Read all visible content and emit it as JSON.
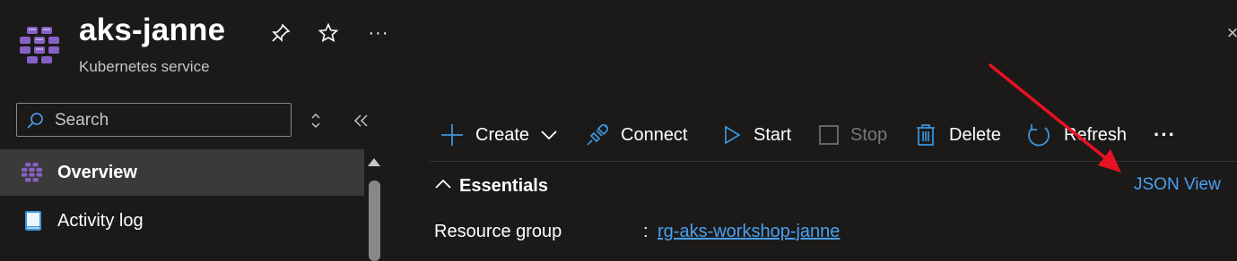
{
  "header": {
    "title": "aks-janne",
    "subtitle": "Kubernetes service",
    "icons": [
      "kubernetes-service-icon",
      "pin-icon",
      "star-icon",
      "more-icon",
      "close-icon"
    ],
    "more_label": "···",
    "close_label": "×"
  },
  "sidebar": {
    "search": {
      "placeholder": "Search",
      "value": ""
    },
    "items": [
      {
        "label": "Overview",
        "icon": "kubernetes-service-icon",
        "selected": true
      },
      {
        "label": "Activity log",
        "icon": "activity-log-icon",
        "selected": false
      }
    ]
  },
  "toolbar": {
    "create_label": "Create",
    "connect_label": "Connect",
    "start_label": "Start",
    "stop_label": "Stop",
    "delete_label": "Delete",
    "refresh_label": "Refresh",
    "more_label": "···"
  },
  "essentials": {
    "label": "Essentials",
    "json_view_label": "JSON View",
    "resource_group_label": "Resource group",
    "resource_group_colon": ":",
    "resource_group_value": "rg-aks-workshop-janne"
  },
  "colors": {
    "background": "#1b1a19",
    "accent_link": "#4aa0f0",
    "icon_blue": "#3a96dd",
    "kubernetes_purple": "#8661c5",
    "annotation_arrow": "#e81123"
  }
}
